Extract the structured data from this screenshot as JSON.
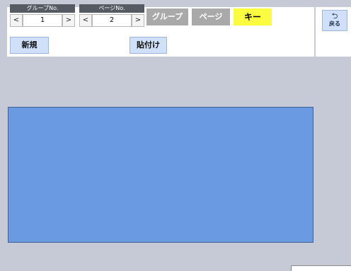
{
  "group_stepper": {
    "caption": "グループNo.",
    "value": "1",
    "prev": "<",
    "next": ">"
  },
  "page_stepper": {
    "caption": "ページNo.",
    "value": "2",
    "prev": "<",
    "next": ">"
  },
  "modes": {
    "group": "グループ",
    "page": "ページ",
    "key": "キー",
    "active": "key"
  },
  "actions": {
    "new": "新規",
    "paste": "貼付け"
  },
  "back": {
    "icon": "undo-arrow-icon",
    "label": "戻る"
  },
  "colors": {
    "background": "#c5cad6",
    "canvas_object": "#6a9ae2",
    "active_mode": "#fbfb3f",
    "inactive_mode": "#a9a9a9",
    "action_button": "#cfe0f8"
  }
}
